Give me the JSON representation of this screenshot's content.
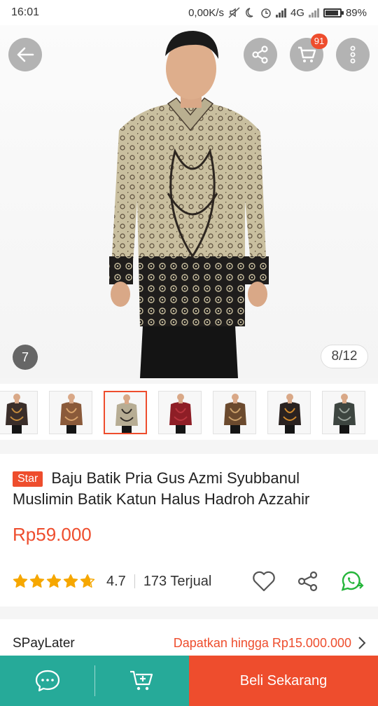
{
  "status_bar": {
    "time": "16:01",
    "net_speed": "0,00K/s",
    "network_type": "4G",
    "battery_percent": "89%",
    "battery_level": 0.89
  },
  "header": {
    "back_icon": "arrow-left-icon",
    "share_icon": "share-icon",
    "cart_icon": "cart-icon",
    "cart_badge": "91",
    "more_icon": "more-vertical-icon"
  },
  "gallery": {
    "promo_number": "7",
    "counter": "8/12",
    "thumbnails": [
      {
        "shirt": "#3a2e2a",
        "pattern": "#c48b3c"
      },
      {
        "shirt": "#8a5a3a",
        "pattern": "#d9a36b"
      },
      {
        "shirt": "#b7ad94",
        "pattern": "#2f2a26"
      },
      {
        "shirt": "#8e1e26",
        "pattern": "#b8353d"
      },
      {
        "shirt": "#6b4a2e",
        "pattern": "#caa06a"
      },
      {
        "shirt": "#2a2220",
        "pattern": "#d28a2c"
      },
      {
        "shirt": "#3d4540",
        "pattern": "#9aa39c"
      }
    ],
    "active_thumbnail": 2
  },
  "product": {
    "badge": "Star",
    "title": "Baju Batik Pria Gus Azmi Syubbanul Muslimin Batik Katun Halus Hadroh Azzahir",
    "price": "Rp59.000",
    "rating": "4.7",
    "rating_value": 4.7,
    "sold": "173 Terjual"
  },
  "spaylater": {
    "label": "SPayLater",
    "promo": "Dapatkan hingga Rp15.000.000"
  },
  "bottom_bar": {
    "chat_icon": "chat-icon",
    "add_to_cart_icon": "add-to-cart-icon",
    "buy_label": "Beli Sekarang"
  },
  "colors": {
    "accent": "#ee4d2d",
    "teal": "#26aa99",
    "star": "#f6a700",
    "whatsapp": "#25b53a"
  }
}
